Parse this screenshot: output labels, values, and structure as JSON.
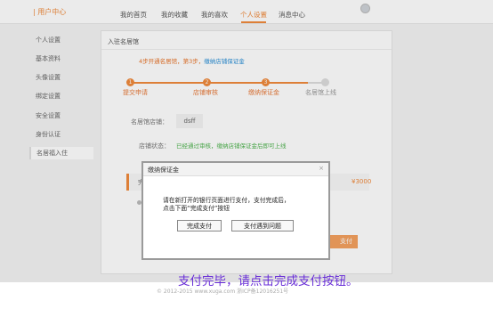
{
  "header": {
    "brand": "| 用户中心",
    "nav": [
      {
        "label": "我的首页",
        "active": false
      },
      {
        "label": "我的收藏",
        "active": false
      },
      {
        "label": "我的喜欢",
        "active": false
      },
      {
        "label": "个人设置",
        "active": true
      },
      {
        "label": "消息中心",
        "active": false
      }
    ]
  },
  "sidebar": {
    "items": [
      {
        "label": "个人设置"
      },
      {
        "label": "基本资料"
      },
      {
        "label": "头像设置"
      },
      {
        "label": "绑定设置"
      },
      {
        "label": "安全设置"
      },
      {
        "label": "身份认证"
      },
      {
        "label": "名居福入住",
        "active": true
      }
    ]
  },
  "main": {
    "title": "入驻名居馆",
    "tip_prefix": "4步开通名居馆，第3步，",
    "tip_link": "缴纳店铺保证金",
    "steps": [
      {
        "num": "1",
        "label": "提交申请",
        "done": true
      },
      {
        "num": "2",
        "label": "店铺审核",
        "done": true
      },
      {
        "num": "3",
        "label": "缴纳保证金",
        "done": true
      },
      {
        "num": "",
        "label": "名居馆上线",
        "done": false
      }
    ],
    "shop_name_label": "名居馆店铺：",
    "shop_name_value": "dsff",
    "status_label": "店铺状态：",
    "status_text": "已经通过审核，缴纳店铺保证金后即可上线",
    "pay_row_label": "完",
    "price": "¥3000",
    "pay_button": "支付"
  },
  "dialog": {
    "title": "缴纳保证金",
    "close": "×",
    "message_line1": "请在新打开的银行页面进行支付，支付完成后，",
    "message_line2": "点击下面“完成支付”按钮",
    "btn_done": "完成支付",
    "btn_problem": "支付遇到问题"
  },
  "annotation": "支付完毕，请点击完成支付按钮。",
  "footer": "© 2012-2015 www.xuga.com 浙ICP备12016251号"
}
